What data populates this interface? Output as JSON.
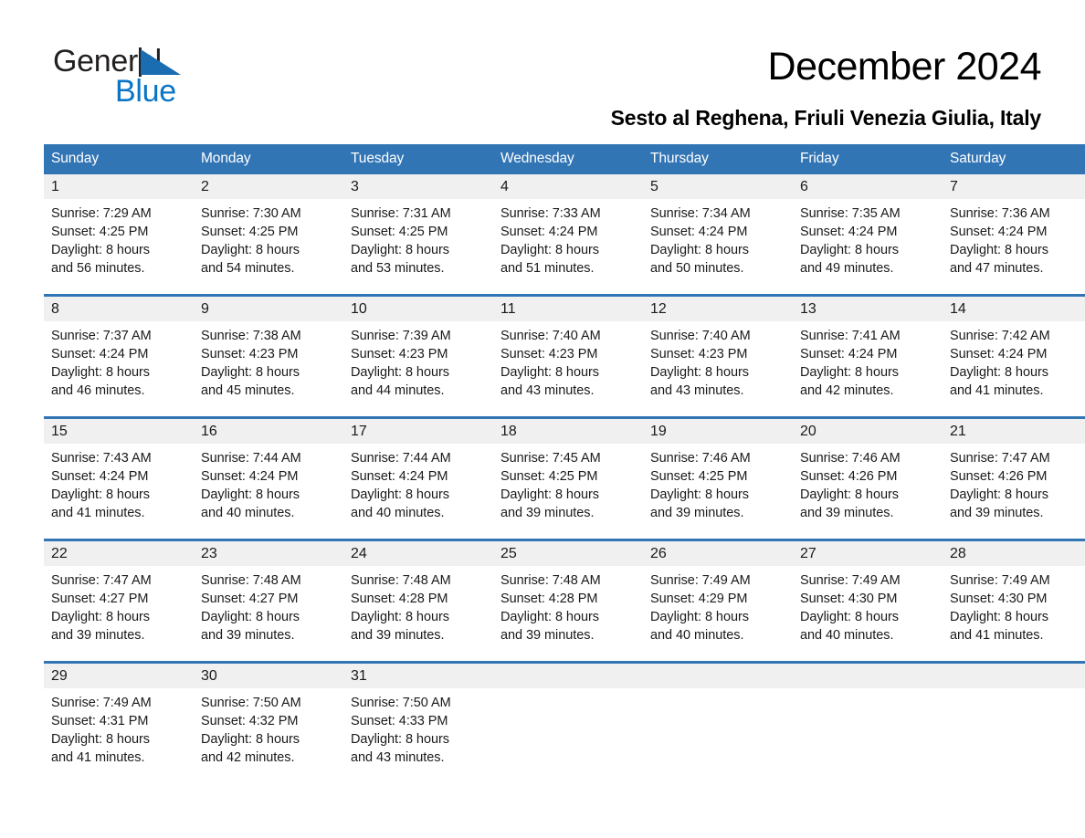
{
  "brand": {
    "name_part1": "General",
    "name_part2": "Blue",
    "triangle_color": "#1a6db0",
    "blue_color": "#0b74c4"
  },
  "header": {
    "title": "December 2024",
    "subtitle": "Sesto al Reghena, Friuli Venezia Giulia, Italy"
  },
  "colors": {
    "header_blue": "#3275b5",
    "daynum_background": "#f0f0f0",
    "text": "#1a1a1a"
  },
  "weekday_headers": [
    "Sunday",
    "Monday",
    "Tuesday",
    "Wednesday",
    "Thursday",
    "Friday",
    "Saturday"
  ],
  "weeks": [
    [
      {
        "day": "1",
        "sunrise": "Sunrise: 7:29 AM",
        "sunset": "Sunset: 4:25 PM",
        "daylight_line1": "Daylight: 8 hours",
        "daylight_line2": "and 56 minutes."
      },
      {
        "day": "2",
        "sunrise": "Sunrise: 7:30 AM",
        "sunset": "Sunset: 4:25 PM",
        "daylight_line1": "Daylight: 8 hours",
        "daylight_line2": "and 54 minutes."
      },
      {
        "day": "3",
        "sunrise": "Sunrise: 7:31 AM",
        "sunset": "Sunset: 4:25 PM",
        "daylight_line1": "Daylight: 8 hours",
        "daylight_line2": "and 53 minutes."
      },
      {
        "day": "4",
        "sunrise": "Sunrise: 7:33 AM",
        "sunset": "Sunset: 4:24 PM",
        "daylight_line1": "Daylight: 8 hours",
        "daylight_line2": "and 51 minutes."
      },
      {
        "day": "5",
        "sunrise": "Sunrise: 7:34 AM",
        "sunset": "Sunset: 4:24 PM",
        "daylight_line1": "Daylight: 8 hours",
        "daylight_line2": "and 50 minutes."
      },
      {
        "day": "6",
        "sunrise": "Sunrise: 7:35 AM",
        "sunset": "Sunset: 4:24 PM",
        "daylight_line1": "Daylight: 8 hours",
        "daylight_line2": "and 49 minutes."
      },
      {
        "day": "7",
        "sunrise": "Sunrise: 7:36 AM",
        "sunset": "Sunset: 4:24 PM",
        "daylight_line1": "Daylight: 8 hours",
        "daylight_line2": "and 47 minutes."
      }
    ],
    [
      {
        "day": "8",
        "sunrise": "Sunrise: 7:37 AM",
        "sunset": "Sunset: 4:24 PM",
        "daylight_line1": "Daylight: 8 hours",
        "daylight_line2": "and 46 minutes."
      },
      {
        "day": "9",
        "sunrise": "Sunrise: 7:38 AM",
        "sunset": "Sunset: 4:23 PM",
        "daylight_line1": "Daylight: 8 hours",
        "daylight_line2": "and 45 minutes."
      },
      {
        "day": "10",
        "sunrise": "Sunrise: 7:39 AM",
        "sunset": "Sunset: 4:23 PM",
        "daylight_line1": "Daylight: 8 hours",
        "daylight_line2": "and 44 minutes."
      },
      {
        "day": "11",
        "sunrise": "Sunrise: 7:40 AM",
        "sunset": "Sunset: 4:23 PM",
        "daylight_line1": "Daylight: 8 hours",
        "daylight_line2": "and 43 minutes."
      },
      {
        "day": "12",
        "sunrise": "Sunrise: 7:40 AM",
        "sunset": "Sunset: 4:23 PM",
        "daylight_line1": "Daylight: 8 hours",
        "daylight_line2": "and 43 minutes."
      },
      {
        "day": "13",
        "sunrise": "Sunrise: 7:41 AM",
        "sunset": "Sunset: 4:24 PM",
        "daylight_line1": "Daylight: 8 hours",
        "daylight_line2": "and 42 minutes."
      },
      {
        "day": "14",
        "sunrise": "Sunrise: 7:42 AM",
        "sunset": "Sunset: 4:24 PM",
        "daylight_line1": "Daylight: 8 hours",
        "daylight_line2": "and 41 minutes."
      }
    ],
    [
      {
        "day": "15",
        "sunrise": "Sunrise: 7:43 AM",
        "sunset": "Sunset: 4:24 PM",
        "daylight_line1": "Daylight: 8 hours",
        "daylight_line2": "and 41 minutes."
      },
      {
        "day": "16",
        "sunrise": "Sunrise: 7:44 AM",
        "sunset": "Sunset: 4:24 PM",
        "daylight_line1": "Daylight: 8 hours",
        "daylight_line2": "and 40 minutes."
      },
      {
        "day": "17",
        "sunrise": "Sunrise: 7:44 AM",
        "sunset": "Sunset: 4:24 PM",
        "daylight_line1": "Daylight: 8 hours",
        "daylight_line2": "and 40 minutes."
      },
      {
        "day": "18",
        "sunrise": "Sunrise: 7:45 AM",
        "sunset": "Sunset: 4:25 PM",
        "daylight_line1": "Daylight: 8 hours",
        "daylight_line2": "and 39 minutes."
      },
      {
        "day": "19",
        "sunrise": "Sunrise: 7:46 AM",
        "sunset": "Sunset: 4:25 PM",
        "daylight_line1": "Daylight: 8 hours",
        "daylight_line2": "and 39 minutes."
      },
      {
        "day": "20",
        "sunrise": "Sunrise: 7:46 AM",
        "sunset": "Sunset: 4:26 PM",
        "daylight_line1": "Daylight: 8 hours",
        "daylight_line2": "and 39 minutes."
      },
      {
        "day": "21",
        "sunrise": "Sunrise: 7:47 AM",
        "sunset": "Sunset: 4:26 PM",
        "daylight_line1": "Daylight: 8 hours",
        "daylight_line2": "and 39 minutes."
      }
    ],
    [
      {
        "day": "22",
        "sunrise": "Sunrise: 7:47 AM",
        "sunset": "Sunset: 4:27 PM",
        "daylight_line1": "Daylight: 8 hours",
        "daylight_line2": "and 39 minutes."
      },
      {
        "day": "23",
        "sunrise": "Sunrise: 7:48 AM",
        "sunset": "Sunset: 4:27 PM",
        "daylight_line1": "Daylight: 8 hours",
        "daylight_line2": "and 39 minutes."
      },
      {
        "day": "24",
        "sunrise": "Sunrise: 7:48 AM",
        "sunset": "Sunset: 4:28 PM",
        "daylight_line1": "Daylight: 8 hours",
        "daylight_line2": "and 39 minutes."
      },
      {
        "day": "25",
        "sunrise": "Sunrise: 7:48 AM",
        "sunset": "Sunset: 4:28 PM",
        "daylight_line1": "Daylight: 8 hours",
        "daylight_line2": "and 39 minutes."
      },
      {
        "day": "26",
        "sunrise": "Sunrise: 7:49 AM",
        "sunset": "Sunset: 4:29 PM",
        "daylight_line1": "Daylight: 8 hours",
        "daylight_line2": "and 40 minutes."
      },
      {
        "day": "27",
        "sunrise": "Sunrise: 7:49 AM",
        "sunset": "Sunset: 4:30 PM",
        "daylight_line1": "Daylight: 8 hours",
        "daylight_line2": "and 40 minutes."
      },
      {
        "day": "28",
        "sunrise": "Sunrise: 7:49 AM",
        "sunset": "Sunset: 4:30 PM",
        "daylight_line1": "Daylight: 8 hours",
        "daylight_line2": "and 41 minutes."
      }
    ],
    [
      {
        "day": "29",
        "sunrise": "Sunrise: 7:49 AM",
        "sunset": "Sunset: 4:31 PM",
        "daylight_line1": "Daylight: 8 hours",
        "daylight_line2": "and 41 minutes."
      },
      {
        "day": "30",
        "sunrise": "Sunrise: 7:50 AM",
        "sunset": "Sunset: 4:32 PM",
        "daylight_line1": "Daylight: 8 hours",
        "daylight_line2": "and 42 minutes."
      },
      {
        "day": "31",
        "sunrise": "Sunrise: 7:50 AM",
        "sunset": "Sunset: 4:33 PM",
        "daylight_line1": "Daylight: 8 hours",
        "daylight_line2": "and 43 minutes."
      },
      {
        "day": "",
        "sunrise": "",
        "sunset": "",
        "daylight_line1": "",
        "daylight_line2": ""
      },
      {
        "day": "",
        "sunrise": "",
        "sunset": "",
        "daylight_line1": "",
        "daylight_line2": ""
      },
      {
        "day": "",
        "sunrise": "",
        "sunset": "",
        "daylight_line1": "",
        "daylight_line2": ""
      },
      {
        "day": "",
        "sunrise": "",
        "sunset": "",
        "daylight_line1": "",
        "daylight_line2": ""
      }
    ]
  ]
}
